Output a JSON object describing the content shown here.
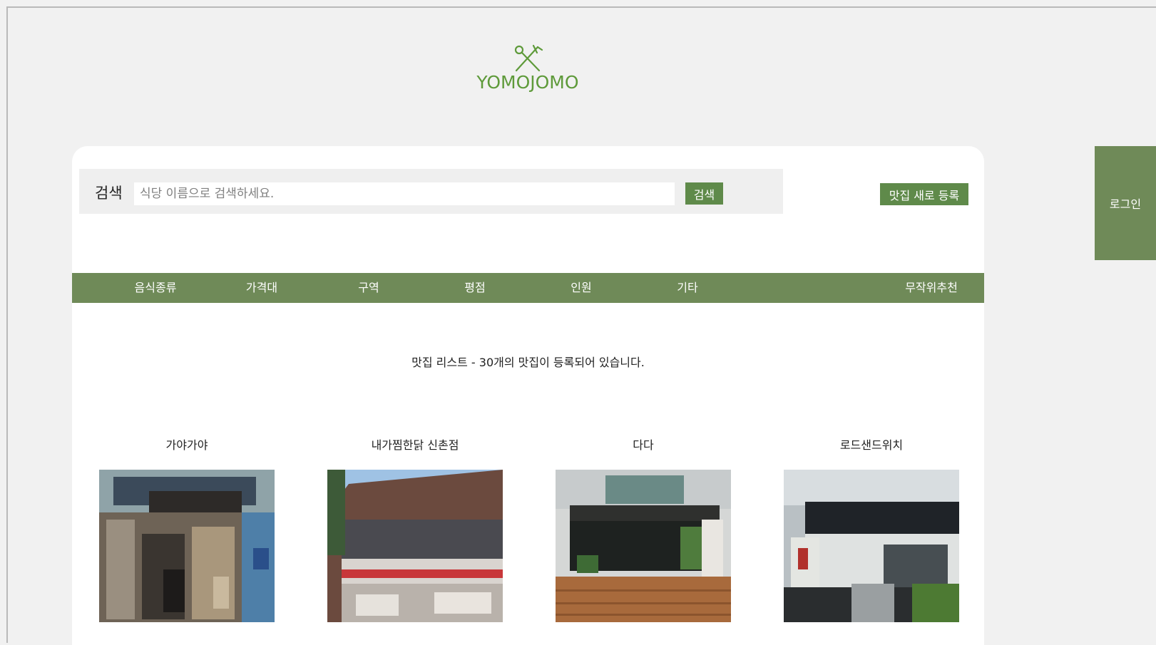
{
  "logo": {
    "icon": "fork-and-knife-crossed-icon",
    "text": "YOMOJOMO",
    "color": "#5e9a3a"
  },
  "login": {
    "label": "로그인"
  },
  "search": {
    "label": "검색",
    "placeholder": "식당 이름으로 검색하세요.",
    "value": "",
    "button_label": "검색"
  },
  "register_button_label": "맛집 새로 등록",
  "nav": {
    "items": [
      {
        "label": "음식종류"
      },
      {
        "label": "가격대"
      },
      {
        "label": "구역"
      },
      {
        "label": "평점"
      },
      {
        "label": "인원"
      },
      {
        "label": "기타"
      },
      {
        "label": "무작위추천"
      }
    ]
  },
  "list_title": "맛집 리스트 - 30개의 맛집이 등록되어 있습니다.",
  "restaurants": [
    {
      "name": "가야가야",
      "photo": "storefront-photo"
    },
    {
      "name": "내가찜한닭 신촌점",
      "photo": "storefront-photo"
    },
    {
      "name": "다다",
      "photo": "storefront-photo"
    },
    {
      "name": "로드샌드위치",
      "photo": "storefront-photo"
    }
  ],
  "colors": {
    "accent": "#6f8a58",
    "button": "#5f8a4a",
    "background": "#f1f1f1",
    "card": "#ffffff"
  }
}
